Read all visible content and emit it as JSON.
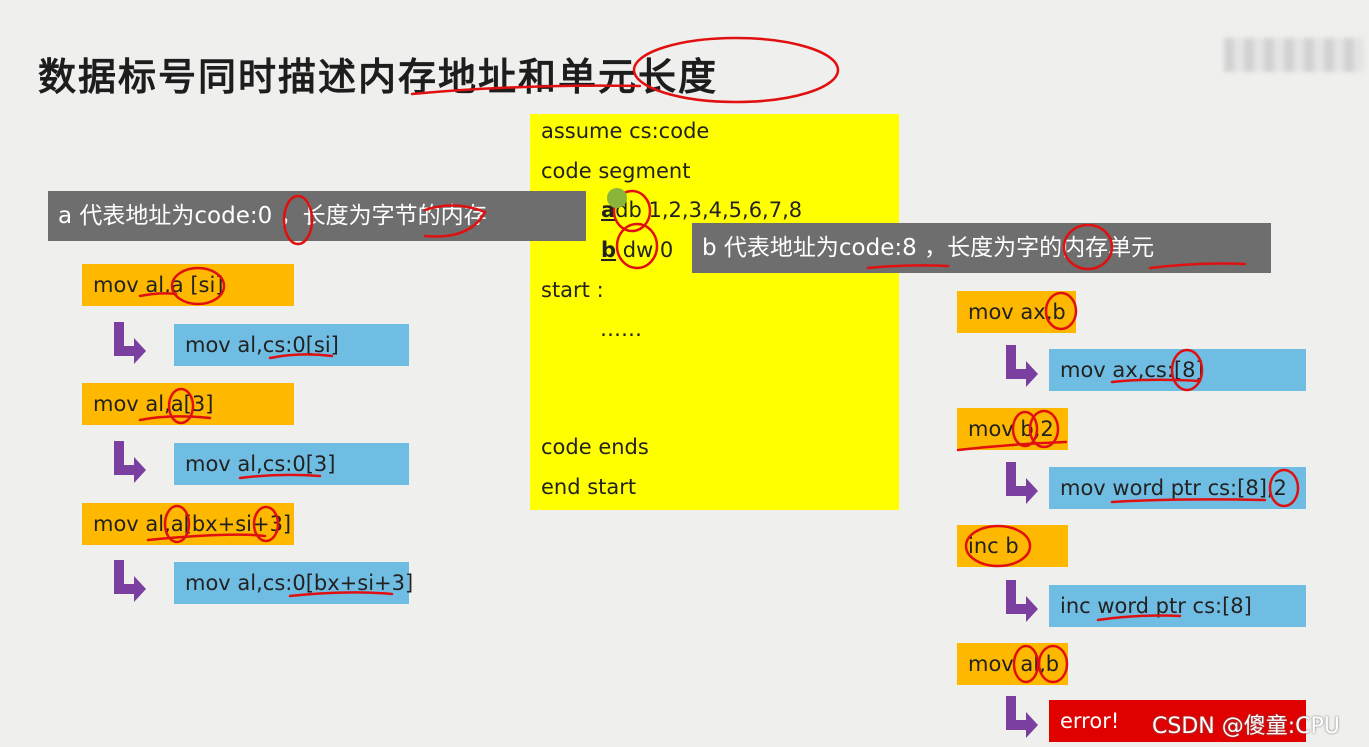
{
  "title": "数据标号同时描述内存地址和单元长度",
  "code": {
    "lines": [
      "assume cs:code",
      "code segment",
      "db 1,2,3,4,5,6,7,8",
      "dw 0",
      "start :",
      "……",
      "code ends",
      "end start"
    ],
    "label_a": "a",
    "label_b": "b"
  },
  "tooltip_a": "a 代表地址为code:0 ，长度为字节的内存",
  "tooltip_b": "b 代表地址为code:8 ，长度为字的内存单元",
  "left_examples": [
    {
      "instr": "mov al,a [si]",
      "translated": "mov al,cs:0[si]"
    },
    {
      "instr": "mov al,a[3]",
      "translated": "mov al,cs:0[3]"
    },
    {
      "instr": "mov al,a[bx+si+3]",
      "translated": "mov al,cs:0[bx+si+3]"
    }
  ],
  "right_examples": [
    {
      "instr": "mov ax,b",
      "translated": "mov ax,cs:[8]"
    },
    {
      "instr": "mov b,2",
      "translated": "mov word ptr cs:[8],2"
    },
    {
      "instr": "inc b",
      "translated": "inc word ptr cs:[8]"
    },
    {
      "instr": "mov al,b",
      "translated": "error!"
    }
  ],
  "watermark": "CSDN @傻童:CPU",
  "colors": {
    "instr_bg": "#ffb800",
    "translated_bg": "#70bde3",
    "code_bg": "#ffff00",
    "error_bg": "#e00000",
    "arrow": "#7b3fa0",
    "annotation": "#e01010"
  },
  "icons": {
    "arrow": "turn-right-arrow-icon"
  }
}
